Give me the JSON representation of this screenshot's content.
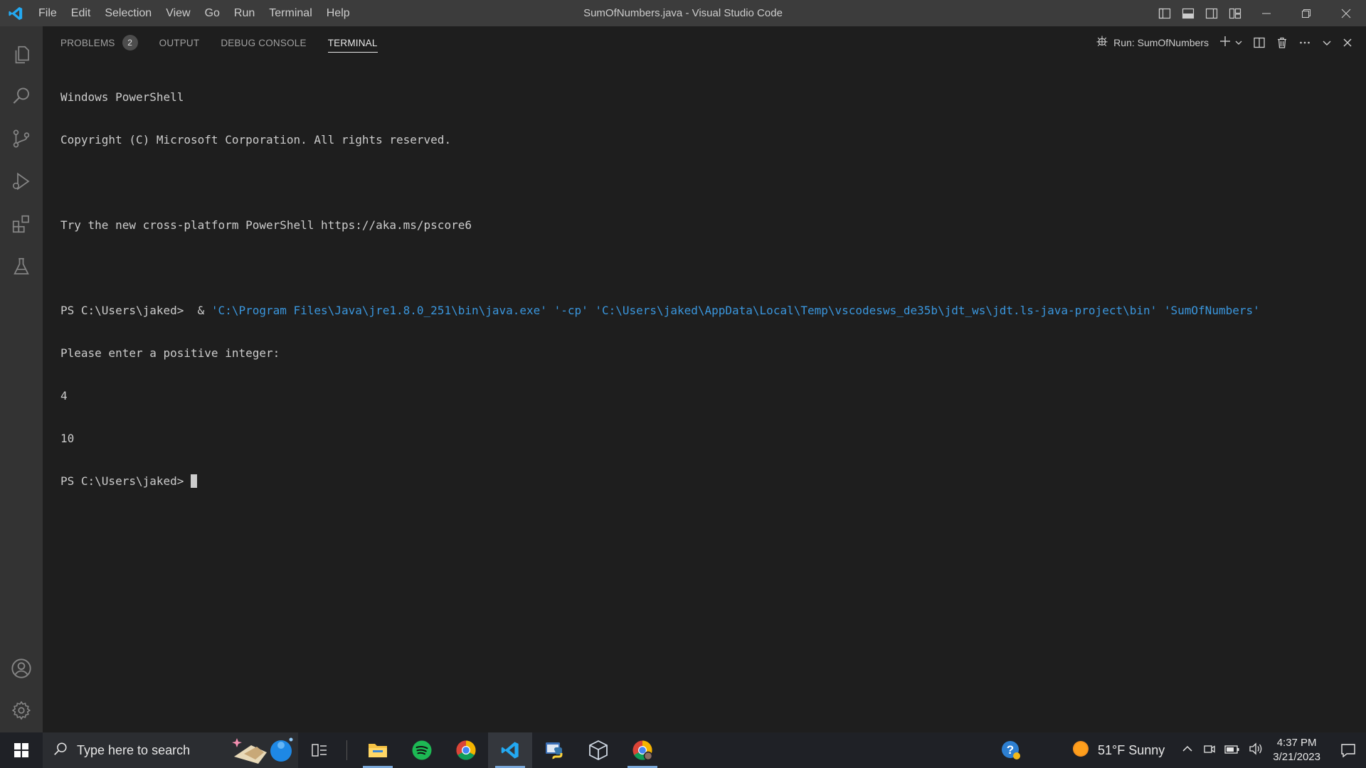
{
  "window": {
    "title": "SumOfNumbers.java - Visual Studio Code"
  },
  "menu": {
    "items": [
      "File",
      "Edit",
      "Selection",
      "View",
      "Go",
      "Run",
      "Terminal",
      "Help"
    ]
  },
  "activity_bar": {
    "items": [
      "explorer-icon",
      "search-icon",
      "source-control-icon",
      "run-debug-icon",
      "extensions-icon",
      "testing-icon"
    ],
    "bottom": [
      "accounts-icon",
      "manage-gear-icon"
    ]
  },
  "panel": {
    "tabs": [
      {
        "label": "PROBLEMS",
        "badge": "2"
      },
      {
        "label": "OUTPUT"
      },
      {
        "label": "DEBUG CONSOLE"
      },
      {
        "label": "TERMINAL",
        "active": true
      }
    ],
    "run_label": "Run: SumOfNumbers"
  },
  "terminal": {
    "lines": [
      "Windows PowerShell",
      "Copyright (C) Microsoft Corporation. All rights reserved.",
      "",
      "Try the new cross-platform PowerShell https://aka.ms/pscore6",
      ""
    ],
    "command_prompt": "PS C:\\Users\\jaked>  & ",
    "command_args": "'C:\\Program Files\\Java\\jre1.8.0_251\\bin\\java.exe' '-cp' 'C:\\Users\\jaked\\AppData\\Local\\Temp\\vscodesws_de35b\\jdt_ws\\jdt.ls-java-project\\bin' 'SumOfNumbers'",
    "output_lines": [
      "Please enter a positive integer:",
      "4",
      "10"
    ],
    "final_prompt": "PS C:\\Users\\jaked> "
  },
  "taskbar": {
    "search_placeholder": "Type here to search",
    "apps": [
      "file-explorer-icon",
      "spotify-icon",
      "chrome-icon",
      "vscode-icon",
      "python-idle-icon",
      "virtualbox-icon",
      "chrome-profile-icon"
    ],
    "weather": "51°F  Sunny",
    "time": "4:37 PM",
    "date": "3/21/2023"
  },
  "colors": {
    "accent_blue": "#3a96dd",
    "vscode_blue": "#23a9f2"
  }
}
